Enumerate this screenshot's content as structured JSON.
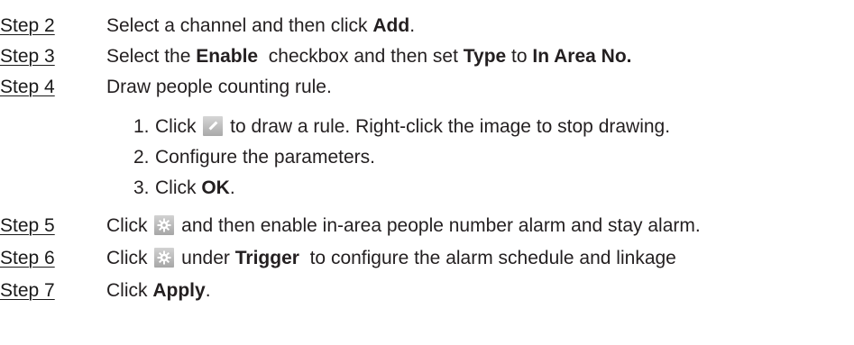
{
  "steps": [
    {
      "label": "Step 2",
      "parts": [
        "Select a channel and then click ",
        "Add",
        "."
      ]
    },
    {
      "label": "Step 3",
      "parts": [
        "Select the ",
        "Enable",
        "  checkbox and then set ",
        "Type",
        " to ",
        "In Area No."
      ]
    },
    {
      "label": "Step 4",
      "parts": [
        "Draw people counting rule."
      ]
    },
    {
      "label": "Step 5",
      "parts": [
        "Click ",
        " and then enable in-area people number alarm and stay alarm."
      ]
    },
    {
      "label": "Step 6",
      "parts": [
        "Click ",
        " under ",
        "Trigger",
        "  to configure the alarm schedule and linkage"
      ]
    },
    {
      "label": "Step 7",
      "parts": [
        "Click ",
        "Apply",
        "."
      ]
    }
  ],
  "substeps": [
    {
      "num": "1.",
      "parts": [
        "Click ",
        " to draw a rule. Right-click the image to stop drawing."
      ]
    },
    {
      "num": "2.",
      "parts": [
        "Configure the parameters."
      ]
    },
    {
      "num": "3.",
      "parts": [
        "Click ",
        "OK",
        "."
      ]
    }
  ],
  "icons": {
    "edit": "pencil-edit-icon",
    "settings": "gear-icon"
  },
  "colors": {
    "text": "#231f20",
    "icon_background": "#b5b5b5"
  }
}
